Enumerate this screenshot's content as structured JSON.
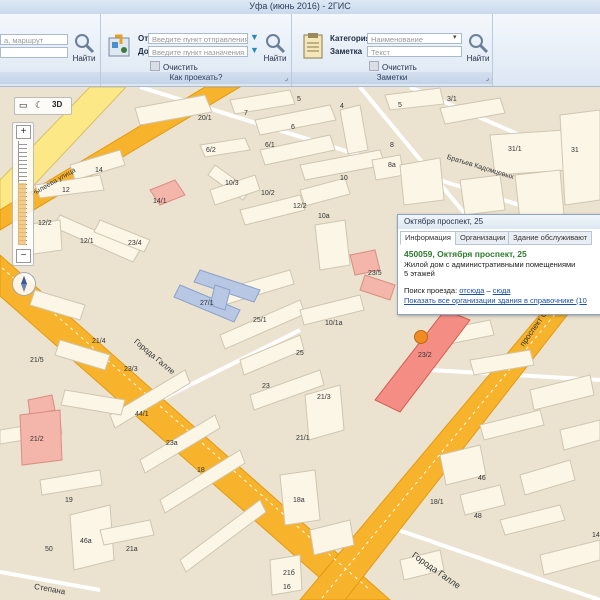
{
  "window": {
    "title": "Уфа (июнь 2016) - 2ГИС"
  },
  "search": {
    "address_placeholder": "а, маршрут",
    "find_label": "Найти"
  },
  "route": {
    "from_label": "От",
    "to_label": "До",
    "from_placeholder": "Введите пункт отправления",
    "to_placeholder": "Введите пункт назначения",
    "find_label": "Найти",
    "clear_label": "Очистить",
    "group_label": "Как проехать?"
  },
  "notes": {
    "category_label": "Категория",
    "note_label": "Заметка",
    "category_placeholder": "Наименование",
    "note_placeholder": "Текст",
    "find_label": "Найти",
    "clear_label": "Очистить",
    "group_label": "Заметки"
  },
  "map_controls": {
    "mode_3d": "3D"
  },
  "popup": {
    "title": "Октября проспект, 25",
    "tabs": [
      "Информация",
      "Организации",
      "Здание обслуживают"
    ],
    "address": "450059, Октября проспект, 25",
    "description": "Жилой дом с административными помещениями",
    "floors": "5 этажей",
    "route_prefix": "Поиск проезда:",
    "route_from": "отсюда",
    "route_dash": "–",
    "route_to": "сюда",
    "all_orgs": "Показать все организации здания в справочнике (10"
  },
  "streets": {
    "gallea": "Города Галле",
    "gallea2": "Города Галле",
    "prospect": "проспект Октября",
    "bratyev": "Братьев Кадомцевых",
    "ryleeva": "Рылеева улица",
    "stepan": "Степана"
  },
  "building_labels": [
    "20/1",
    "7",
    "5",
    "6",
    "4",
    "5",
    "3/1",
    "8",
    "6/2",
    "6/1",
    "31/1",
    "31",
    "14",
    "10",
    "8а",
    "10/3",
    "14/1",
    "12",
    "10/2",
    "12/2",
    "10а",
    "12/2",
    "12/1",
    "23/4",
    "27/1",
    "23/5",
    "25/1",
    "10/1а",
    "21/5",
    "21/4",
    "23/3",
    "25",
    "23/2",
    "23",
    "21/3",
    "44/1",
    "21/2",
    "23а",
    "21/1",
    "18",
    "46",
    "19",
    "18а",
    "18/1",
    "48",
    "46а",
    "50",
    "21а",
    "21б",
    "16",
    "14"
  ]
}
